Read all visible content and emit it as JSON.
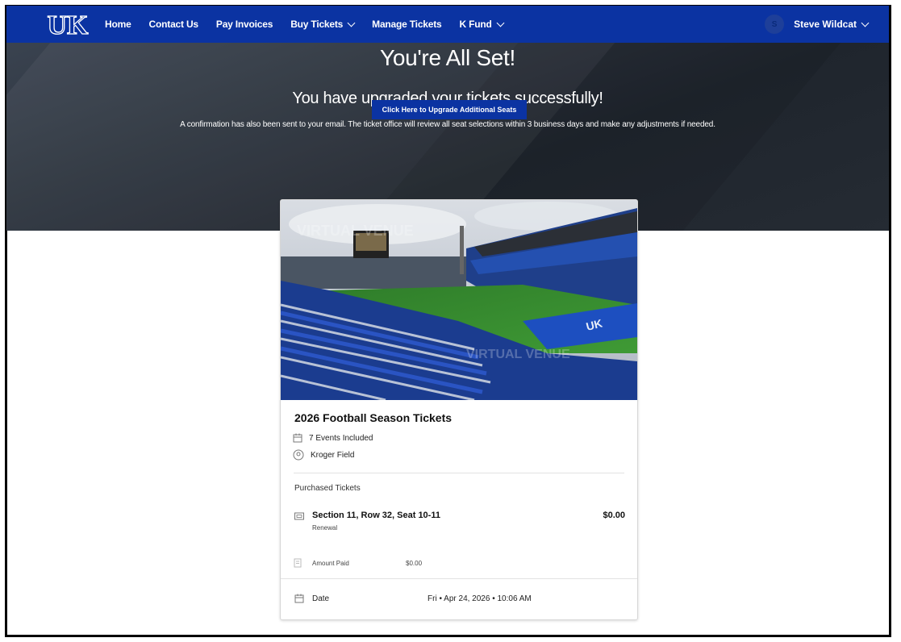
{
  "nav": {
    "logo_text": "UK",
    "links": [
      {
        "label": "Home",
        "dropdown": false
      },
      {
        "label": "Contact Us",
        "dropdown": false
      },
      {
        "label": "Pay Invoices",
        "dropdown": false
      },
      {
        "label": "Buy Tickets",
        "dropdown": true
      },
      {
        "label": "Manage Tickets",
        "dropdown": false
      },
      {
        "label": "K Fund",
        "dropdown": true
      }
    ],
    "user": {
      "initial": "S",
      "name": "Steve Wildcat"
    }
  },
  "hero": {
    "title": "You're All Set!",
    "subtitle": "You have upgraded your tickets successfully!",
    "message": "A confirmation has also been sent to your email. The ticket office will review all seat selections within 3 business days and make any adjustments if needed.",
    "cta_label": "Click Here to Upgrade Additional Seats"
  },
  "card": {
    "image_watermark": "VIRTUAL VENUE",
    "image_watermark2": "VIRTUAL VENUE",
    "title": "2026 Football Season Tickets",
    "events": "7 Events Included",
    "venue": "Kroger Field",
    "purchased_label": "Purchased Tickets",
    "ticket": {
      "title": "Section 11, Row 32, Seat 10-11",
      "type": "Renewal",
      "price": "$0.00"
    },
    "amount_paid_label": "Amount Paid",
    "amount_paid_value": "$0.00",
    "date_label": "Date",
    "date_value": "Fri • Apr 24, 2026 • 10:06 AM"
  },
  "colors": {
    "brand_blue": "#0b33a2",
    "hero_dark": "#2a313b"
  }
}
